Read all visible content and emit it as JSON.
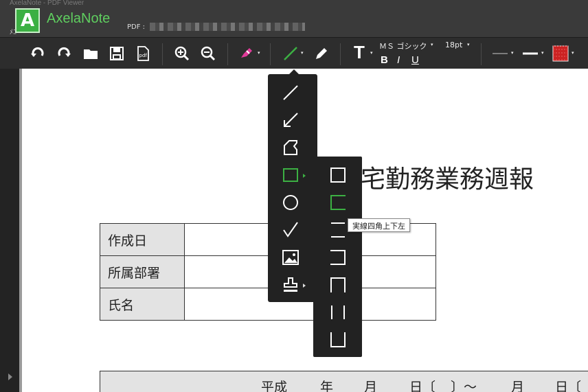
{
  "titlebar": {
    "window_title": "AxelaNote - PDF Viewer",
    "menu_hint": "ﾒﾆ",
    "app_name": "AxelaNote",
    "logo_letter": "A",
    "pdf_label": "PDF :",
    "brand_color": "#3cb043"
  },
  "toolbar": {
    "icons": [
      "rotate-left-icon",
      "rotate-right-icon",
      "folder-icon",
      "save-icon",
      "pdf-export-icon",
      "zoom-in-icon",
      "zoom-out-icon",
      "highlighter-icon",
      "line-tool-icon",
      "pen-icon",
      "text-tool-icon",
      "line-style-icon",
      "line-width-icon",
      "color-swatch-icon"
    ],
    "pdf_icon_text": "pdf",
    "text_icon": "T",
    "font_name": "ＭＳ ゴシック",
    "font_size": "18pt",
    "bold_label": "B",
    "italic_label": "I",
    "underline_label": "U",
    "dropdown_glyph": "▾",
    "active_color": "#cc2222"
  },
  "document": {
    "title": "宅勤務業務週報",
    "info_rows": [
      {
        "label": "作成日",
        "value": ""
      },
      {
        "label": "所属部署",
        "value": ""
      },
      {
        "label": "氏名",
        "value": ""
      }
    ],
    "period_row": [
      "平成",
      "年",
      "月",
      "日〔",
      "〕～",
      "月",
      "日〔"
    ]
  },
  "shape_menu": {
    "items": [
      "line-icon",
      "arrow-icon",
      "freeform-shape-icon",
      "rectangle-icon",
      "ellipse-icon",
      "checkmark-icon",
      "image-icon",
      "stamp-icon"
    ],
    "selected": "rectangle-icon",
    "accent": "#3cb043"
  },
  "rect_submenu": {
    "items": [
      "rect-all-sides-icon",
      "rect-top-bottom-left-icon",
      "rect-top-bottom-icon",
      "rect-top-bottom-right-icon",
      "rect-top-left-right-icon",
      "rect-left-right-icon",
      "rect-bottom-left-right-icon"
    ],
    "hovered": "rect-top-bottom-left-icon"
  },
  "tooltip": {
    "text": "実線四角上下左"
  }
}
